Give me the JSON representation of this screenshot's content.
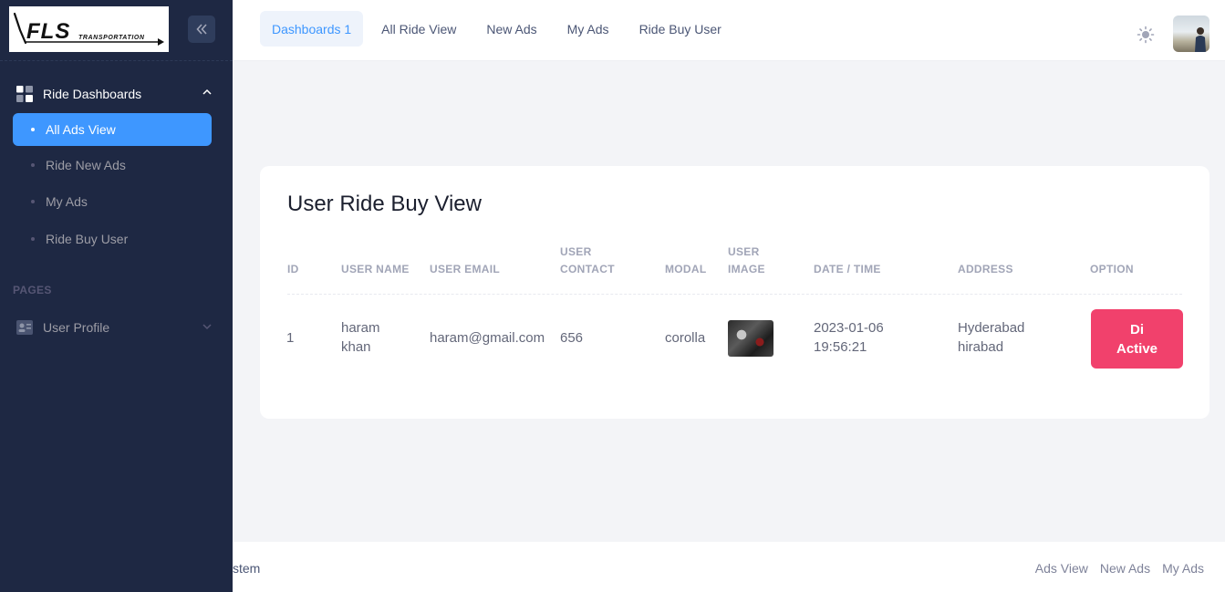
{
  "topnav": {
    "tabs": [
      {
        "label": "Dashboards 1",
        "active": true
      },
      {
        "label": "All Ride View",
        "active": false
      },
      {
        "label": "New Ads",
        "active": false
      },
      {
        "label": "My Ads",
        "active": false
      },
      {
        "label": "Ride Buy User",
        "active": false
      }
    ]
  },
  "sidebar": {
    "logo_text": "FLS TRANSPORTATION",
    "group": {
      "label": "Ride Dashboards",
      "items": [
        {
          "label": "All Ads View",
          "active": true
        },
        {
          "label": "Ride New Ads",
          "active": false
        },
        {
          "label": "My Ads",
          "active": false
        },
        {
          "label": "Ride Buy User",
          "active": false
        }
      ]
    },
    "section_label": "PAGES",
    "profile_label": "User Profile"
  },
  "card": {
    "title": "User Ride Buy View",
    "headers": {
      "id": "ID",
      "user_name": "USER NAME",
      "user_email": "USER EMAIL",
      "user_contact_1": "USER",
      "user_contact_2": "CONTACT",
      "modal": "MODAL",
      "user_image_1": "USER",
      "user_image_2": "IMAGE",
      "date_time": "DATE / TIME",
      "address": "ADDRESS",
      "option": "OPTION"
    },
    "rows": [
      {
        "id": "1",
        "user_name_1": "haram",
        "user_name_2": "khan",
        "user_email": "haram@gmail.com",
        "user_contact": "656",
        "modal": "corolla",
        "date_1": "2023-01-06",
        "date_2": "19:56:21",
        "address_1": "Hyderabad",
        "address_2": "hirabad",
        "option_1": "Di",
        "option_2": "Active"
      }
    ]
  },
  "footer": {
    "text": "stem",
    "links": [
      "Ads View",
      "New Ads",
      "My Ads"
    ]
  },
  "colors": {
    "sidebar_bg": "#1e2843",
    "accent": "#3e97ff",
    "danger": "#f1416c"
  },
  "icons": {
    "collapse": "double-chevron-left-icon",
    "dashboard": "grid-icon",
    "profile": "profile-card-icon",
    "theme": "sun-icon"
  }
}
